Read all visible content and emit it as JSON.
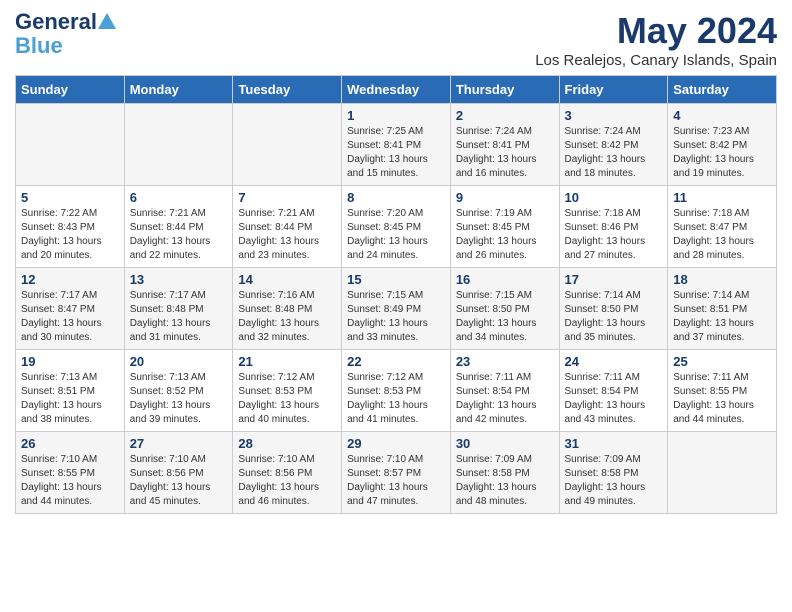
{
  "header": {
    "logo_general": "General",
    "logo_blue": "Blue",
    "month_title": "May 2024",
    "location": "Los Realejos, Canary Islands, Spain"
  },
  "days_of_week": [
    "Sunday",
    "Monday",
    "Tuesday",
    "Wednesday",
    "Thursday",
    "Friday",
    "Saturday"
  ],
  "weeks": [
    [
      {
        "day": "",
        "info": ""
      },
      {
        "day": "",
        "info": ""
      },
      {
        "day": "",
        "info": ""
      },
      {
        "day": "1",
        "info": "Sunrise: 7:25 AM\nSunset: 8:41 PM\nDaylight: 13 hours and 15 minutes."
      },
      {
        "day": "2",
        "info": "Sunrise: 7:24 AM\nSunset: 8:41 PM\nDaylight: 13 hours and 16 minutes."
      },
      {
        "day": "3",
        "info": "Sunrise: 7:24 AM\nSunset: 8:42 PM\nDaylight: 13 hours and 18 minutes."
      },
      {
        "day": "4",
        "info": "Sunrise: 7:23 AM\nSunset: 8:42 PM\nDaylight: 13 hours and 19 minutes."
      }
    ],
    [
      {
        "day": "5",
        "info": "Sunrise: 7:22 AM\nSunset: 8:43 PM\nDaylight: 13 hours and 20 minutes."
      },
      {
        "day": "6",
        "info": "Sunrise: 7:21 AM\nSunset: 8:44 PM\nDaylight: 13 hours and 22 minutes."
      },
      {
        "day": "7",
        "info": "Sunrise: 7:21 AM\nSunset: 8:44 PM\nDaylight: 13 hours and 23 minutes."
      },
      {
        "day": "8",
        "info": "Sunrise: 7:20 AM\nSunset: 8:45 PM\nDaylight: 13 hours and 24 minutes."
      },
      {
        "day": "9",
        "info": "Sunrise: 7:19 AM\nSunset: 8:45 PM\nDaylight: 13 hours and 26 minutes."
      },
      {
        "day": "10",
        "info": "Sunrise: 7:18 AM\nSunset: 8:46 PM\nDaylight: 13 hours and 27 minutes."
      },
      {
        "day": "11",
        "info": "Sunrise: 7:18 AM\nSunset: 8:47 PM\nDaylight: 13 hours and 28 minutes."
      }
    ],
    [
      {
        "day": "12",
        "info": "Sunrise: 7:17 AM\nSunset: 8:47 PM\nDaylight: 13 hours and 30 minutes."
      },
      {
        "day": "13",
        "info": "Sunrise: 7:17 AM\nSunset: 8:48 PM\nDaylight: 13 hours and 31 minutes."
      },
      {
        "day": "14",
        "info": "Sunrise: 7:16 AM\nSunset: 8:48 PM\nDaylight: 13 hours and 32 minutes."
      },
      {
        "day": "15",
        "info": "Sunrise: 7:15 AM\nSunset: 8:49 PM\nDaylight: 13 hours and 33 minutes."
      },
      {
        "day": "16",
        "info": "Sunrise: 7:15 AM\nSunset: 8:50 PM\nDaylight: 13 hours and 34 minutes."
      },
      {
        "day": "17",
        "info": "Sunrise: 7:14 AM\nSunset: 8:50 PM\nDaylight: 13 hours and 35 minutes."
      },
      {
        "day": "18",
        "info": "Sunrise: 7:14 AM\nSunset: 8:51 PM\nDaylight: 13 hours and 37 minutes."
      }
    ],
    [
      {
        "day": "19",
        "info": "Sunrise: 7:13 AM\nSunset: 8:51 PM\nDaylight: 13 hours and 38 minutes."
      },
      {
        "day": "20",
        "info": "Sunrise: 7:13 AM\nSunset: 8:52 PM\nDaylight: 13 hours and 39 minutes."
      },
      {
        "day": "21",
        "info": "Sunrise: 7:12 AM\nSunset: 8:53 PM\nDaylight: 13 hours and 40 minutes."
      },
      {
        "day": "22",
        "info": "Sunrise: 7:12 AM\nSunset: 8:53 PM\nDaylight: 13 hours and 41 minutes."
      },
      {
        "day": "23",
        "info": "Sunrise: 7:11 AM\nSunset: 8:54 PM\nDaylight: 13 hours and 42 minutes."
      },
      {
        "day": "24",
        "info": "Sunrise: 7:11 AM\nSunset: 8:54 PM\nDaylight: 13 hours and 43 minutes."
      },
      {
        "day": "25",
        "info": "Sunrise: 7:11 AM\nSunset: 8:55 PM\nDaylight: 13 hours and 44 minutes."
      }
    ],
    [
      {
        "day": "26",
        "info": "Sunrise: 7:10 AM\nSunset: 8:55 PM\nDaylight: 13 hours and 44 minutes."
      },
      {
        "day": "27",
        "info": "Sunrise: 7:10 AM\nSunset: 8:56 PM\nDaylight: 13 hours and 45 minutes."
      },
      {
        "day": "28",
        "info": "Sunrise: 7:10 AM\nSunset: 8:56 PM\nDaylight: 13 hours and 46 minutes."
      },
      {
        "day": "29",
        "info": "Sunrise: 7:10 AM\nSunset: 8:57 PM\nDaylight: 13 hours and 47 minutes."
      },
      {
        "day": "30",
        "info": "Sunrise: 7:09 AM\nSunset: 8:58 PM\nDaylight: 13 hours and 48 minutes."
      },
      {
        "day": "31",
        "info": "Sunrise: 7:09 AM\nSunset: 8:58 PM\nDaylight: 13 hours and 49 minutes."
      },
      {
        "day": "",
        "info": ""
      }
    ]
  ]
}
